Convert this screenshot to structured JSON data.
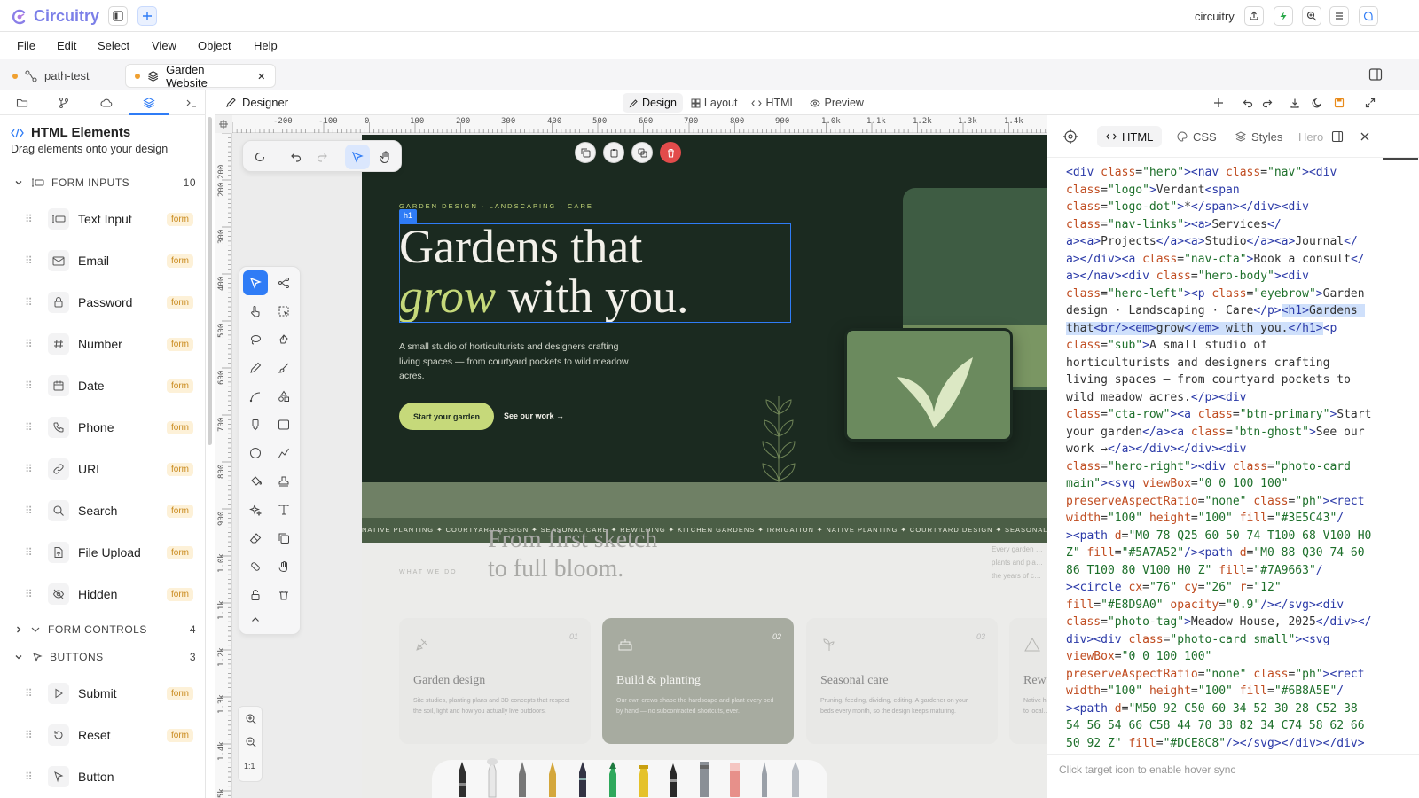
{
  "app": {
    "name": "Circuitry",
    "workspace": "circuitry"
  },
  "menu": [
    "File",
    "Edit",
    "Select",
    "View",
    "Object",
    "Help"
  ],
  "tabs": [
    {
      "label": "path-test",
      "active": false
    },
    {
      "label": "Garden Website",
      "active": true
    }
  ],
  "left_panel": {
    "title": "HTML Elements",
    "subtitle": "Drag elements onto your design",
    "categories": [
      {
        "label": "FORM INPUTS",
        "count": "10"
      },
      {
        "label": "FORM CONTROLS",
        "count": "4"
      },
      {
        "label": "BUTTONS",
        "count": "3"
      }
    ],
    "form_inputs": [
      {
        "label": "Text Input",
        "badge": "form",
        "icon": "text-input-icon"
      },
      {
        "label": "Email",
        "badge": "form",
        "icon": "mail-icon"
      },
      {
        "label": "Password",
        "badge": "form",
        "icon": "lock-icon"
      },
      {
        "label": "Number",
        "badge": "form",
        "icon": "hash-icon"
      },
      {
        "label": "Date",
        "badge": "form",
        "icon": "calendar-icon"
      },
      {
        "label": "Phone",
        "badge": "form",
        "icon": "phone-icon"
      },
      {
        "label": "URL",
        "badge": "form",
        "icon": "link-icon"
      },
      {
        "label": "Search",
        "badge": "form",
        "icon": "search-icon"
      },
      {
        "label": "File Upload",
        "badge": "form",
        "icon": "file-upload-icon"
      },
      {
        "label": "Hidden",
        "badge": "form",
        "icon": "eye-off-icon"
      }
    ],
    "buttons": [
      {
        "label": "Submit",
        "badge": "form",
        "icon": "play-icon"
      },
      {
        "label": "Reset",
        "badge": "form",
        "icon": "reset-icon"
      },
      {
        "label": "Button",
        "badge": "",
        "icon": "pointer-icon"
      }
    ]
  },
  "designer": {
    "title": "Designer",
    "modes": [
      "Design",
      "Layout",
      "HTML",
      "Preview"
    ],
    "active_mode": "Design"
  },
  "ruler": {
    "h": [
      "-200",
      "-100",
      "0",
      "100",
      "200",
      "300",
      "400",
      "500",
      "600",
      "700",
      "800",
      "900",
      "1.0k",
      "1.1k",
      "1.2k",
      "1.3k",
      "1.4k"
    ],
    "v": [
      "200",
      "300",
      "400",
      "500",
      "600",
      "700",
      "800",
      "900",
      "1.0k",
      "1.1k",
      "1.2k",
      "1.3k",
      "1.4k",
      "1.5k"
    ]
  },
  "zoom": {
    "reset_label": "1:1"
  },
  "site": {
    "selection_tag": "h1",
    "eyebrow": "GARDEN DESIGN · LANDSCAPING · CARE",
    "h1_line1": "Gardens that",
    "h1_em": "grow",
    "h1_rest": " with you.",
    "sub": "A small studio of horticulturists and designers crafting living spaces — from courtyard pockets to wild meadow acres.",
    "btn_primary": "Start your garden",
    "btn_ghost": "See our work →",
    "marquee": "NATIVE PLANTING ✦ COURTYARD DESIGN ✦ SEASONAL CARE ✦ REWILDING ✦ KITCHEN GARDENS ✦ IRRIGATION ✦ NATIVE PLANTING ✦ COURTYARD DESIGN ✦ SEASONAL CARE",
    "section_eyebrow": "WHAT WE DO",
    "section_title_1": "From first sketch",
    "section_title_2": "to full bloom.",
    "section_side": "Every garden … plants and pla… the years of c…",
    "cards": [
      {
        "num": "01",
        "title": "Garden design",
        "desc": "Site studies, planting plans and 3D concepts that respect the soil, light and how you actually live outdoors."
      },
      {
        "num": "02",
        "title": "Build & planting",
        "desc": "Our own crews shape the hardscape and plant every bed by hand — no subcontracted shortcuts, ever."
      },
      {
        "num": "03",
        "title": "Seasonal care",
        "desc": "Pruning, feeding, dividing, editing. A gardener on your beds every month, so the design keeps maturing."
      },
      {
        "num": "",
        "title": "Rew…",
        "desc": "Native h… to local…"
      }
    ]
  },
  "right_panel": {
    "tabs": [
      "HTML",
      "CSS",
      "Styles"
    ],
    "active_tab": "HTML",
    "context": "Hero",
    "footer": "Click target icon to enable hover sync"
  },
  "colors": {
    "accent": "#2f7cf6",
    "hero_bg": "#1b2a20",
    "lime": "#c6d97a",
    "card_green": "#6b8a5e",
    "brand_gradient": [
      "#6a7cf0",
      "#b57de0"
    ]
  }
}
